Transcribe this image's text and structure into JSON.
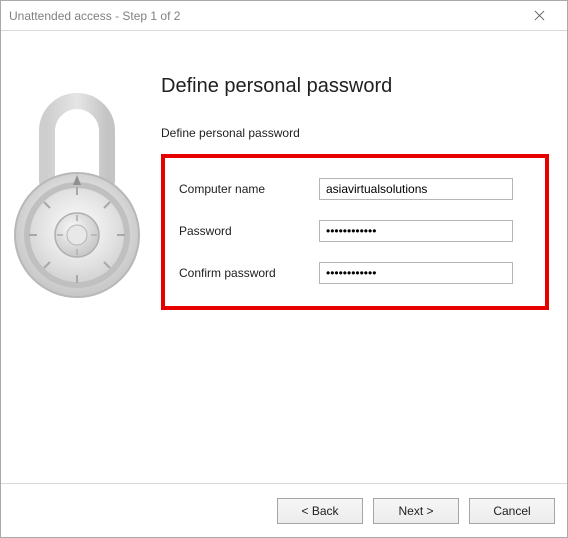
{
  "window": {
    "title": "Unattended access - Step 1 of 2"
  },
  "page": {
    "heading": "Define personal password",
    "subheading": "Define personal password"
  },
  "form": {
    "computer_name_label": "Computer name",
    "computer_name_value": "asiavirtualsolutions",
    "password_label": "Password",
    "password_value": "••••••••••••",
    "confirm_label": "Confirm password",
    "confirm_value": "••••••••••••"
  },
  "buttons": {
    "back": "< Back",
    "next": "Next >",
    "cancel": "Cancel"
  }
}
